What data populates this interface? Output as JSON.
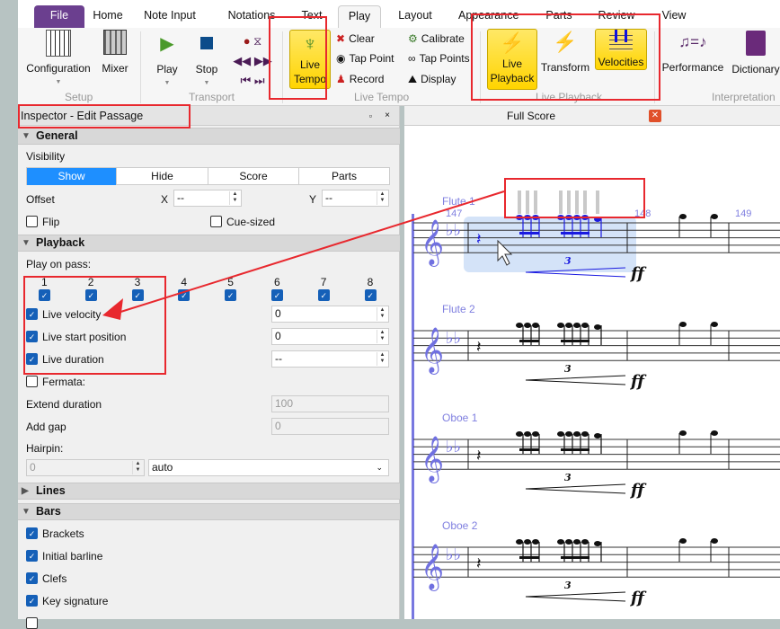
{
  "tabs": [
    "File",
    "Home",
    "Note Input",
    "Notations",
    "Text",
    "Play",
    "Layout",
    "Appearance",
    "Parts",
    "Review",
    "View"
  ],
  "active_tab": "Play",
  "ribbon": {
    "setup": {
      "label": "Setup",
      "configuration": "Configuration",
      "mixer": "Mixer"
    },
    "transport": {
      "label": "Transport",
      "play": "Play",
      "stop": "Stop"
    },
    "live_tempo": {
      "label": "Live Tempo",
      "live_tempo": "Live Tempo",
      "clear": "Clear",
      "tap_point": "Tap Point",
      "record": "Record",
      "calibrate": "Calibrate",
      "tap_points": "Tap Points",
      "display": "Display"
    },
    "live_playback": {
      "label": "Live Playback",
      "live_playback": "Live Playback",
      "transform": "Transform",
      "velocities": "Velocities"
    },
    "interpretation": {
      "label": "Interpretation",
      "performance": "Performance",
      "dictionary": "Dictionary"
    }
  },
  "inspector": {
    "title": "Inspector - Edit Passage",
    "general": {
      "header": "General",
      "visibility": "Visibility",
      "segments": [
        "Show",
        "Hide",
        "Score",
        "Parts"
      ],
      "selected": "Show",
      "offset": "Offset",
      "x_label": "X",
      "x_value": "--",
      "y_label": "Y",
      "y_value": "--",
      "flip": "Flip",
      "cue_sized": "Cue-sized"
    },
    "playback": {
      "header": "Playback",
      "play_on_pass": "Play on pass:",
      "passes": [
        "1",
        "2",
        "3",
        "4",
        "5",
        "6",
        "7",
        "8"
      ],
      "live_velocity": "Live velocity",
      "live_velocity_value": "0",
      "live_start": "Live start position",
      "live_start_value": "0",
      "live_duration": "Live duration",
      "live_duration_value": "--",
      "fermata": "Fermata:",
      "extend_duration": "Extend duration",
      "extend_value": "100",
      "add_gap": "Add gap",
      "gap_value": "0",
      "hairpin": "Hairpin:",
      "hairpin_value": "0",
      "hairpin_mode": "auto"
    },
    "lines": {
      "header": "Lines"
    },
    "bars": {
      "header": "Bars",
      "items": [
        "Brackets",
        "Initial barline",
        "Clefs",
        "Key signature"
      ]
    }
  },
  "score": {
    "tab": "Full Score",
    "instruments": [
      "Flute 1",
      "Flute 2",
      "Oboe 1",
      "Oboe 2"
    ],
    "bar_numbers": [
      "147",
      "148",
      "149"
    ],
    "tuplet": "3",
    "dynamic": "ff"
  },
  "colors": {
    "accent": "#1e8fff",
    "file_tab": "#6b3f8f",
    "annotation": "#e8282e",
    "selection": "#cfe0f7"
  }
}
